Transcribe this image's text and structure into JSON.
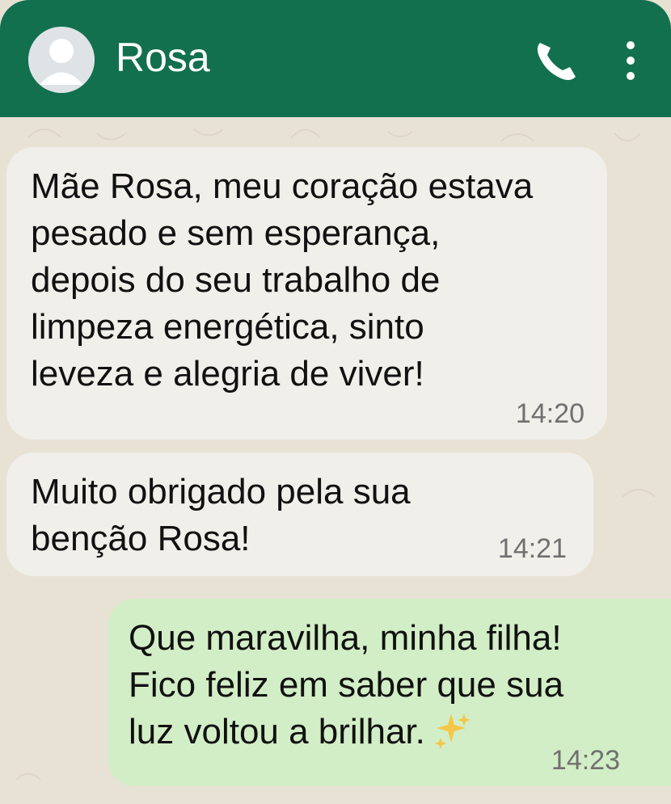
{
  "header": {
    "contact_name": "Rosa",
    "icons": [
      "avatar-icon",
      "phone-icon",
      "more-vertical-icon"
    ]
  },
  "messages": [
    {
      "direction": "incoming",
      "text": "Mãe Rosa, meu coração estava\npesado e sem esperança,\ndepois do seu trabalho de\nlimpeza energética, sinto\nleveza e alegria de viver!",
      "time": "14:20"
    },
    {
      "direction": "incoming",
      "text": "Muito obrigado pela sua\nbenção Rosa!",
      "time": "14:21"
    },
    {
      "direction": "outgoing",
      "text": "Que maravilha, minha filha!\nFico feliz em saber que sua\nluz voltou a brilhar.",
      "emoji": "sparkles-icon",
      "time": "14:23"
    }
  ],
  "colors": {
    "header": "#12704f",
    "chat_background": "#e8e2d5",
    "incoming_bubble": "#f0efea",
    "outgoing_bubble": "#d2eec6",
    "timestamp": "#707070",
    "sparkles": "#f3c84a"
  }
}
